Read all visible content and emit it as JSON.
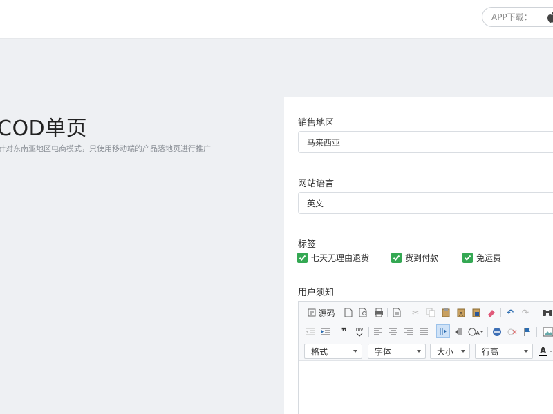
{
  "topbar": {
    "app_download_label": "APP下载："
  },
  "hero": {
    "title": "COD单页",
    "subtitle": "针对东南亚地区电商模式，只使用移动端的产品落地页进行推广"
  },
  "form": {
    "region": {
      "label": "销售地区",
      "value": "马来西亚"
    },
    "language": {
      "label": "网站语言",
      "value": "英文"
    },
    "tags": {
      "label": "标签",
      "items": [
        "七天无理由退货",
        "货到付款",
        "免运费"
      ]
    },
    "notice": {
      "label": "用户须知",
      "toolbar": {
        "source_label": "源码",
        "format_select": "格式",
        "font_select": "字体",
        "size_select": "大小",
        "lineheight_select": "行高"
      }
    }
  },
  "colors": {
    "checkbox_green": "#34a853",
    "page_bg": "#eef0f3",
    "active_button": "#cfe2f7"
  }
}
